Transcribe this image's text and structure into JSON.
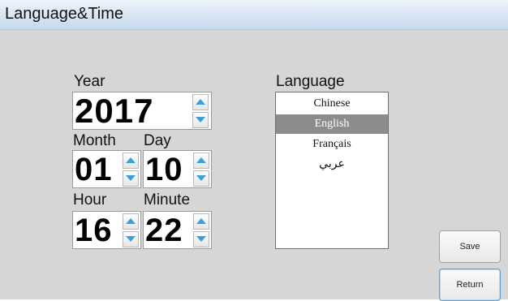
{
  "window": {
    "title": "Language&Time"
  },
  "date_time": {
    "year": {
      "label": "Year",
      "value": "2017"
    },
    "month": {
      "label": "Month",
      "value": "01"
    },
    "day": {
      "label": "Day",
      "value": "10"
    },
    "hour": {
      "label": "Hour",
      "value": "16"
    },
    "minute": {
      "label": "Minute",
      "value": "22"
    }
  },
  "language": {
    "label": "Language",
    "options": [
      "Chinese",
      "English",
      "Français",
      "عربي"
    ],
    "selected": "English"
  },
  "buttons": {
    "save": "Save",
    "return": "Return"
  },
  "icons": {
    "spin_up": "spin-up-icon",
    "spin_down": "spin-down-icon"
  },
  "colors": {
    "title_bar": "#d7e5f3",
    "panel_background": "#d6d6d6",
    "spinner_arrow": "#3aa0dc",
    "selected_item": "#8c8c8c"
  }
}
